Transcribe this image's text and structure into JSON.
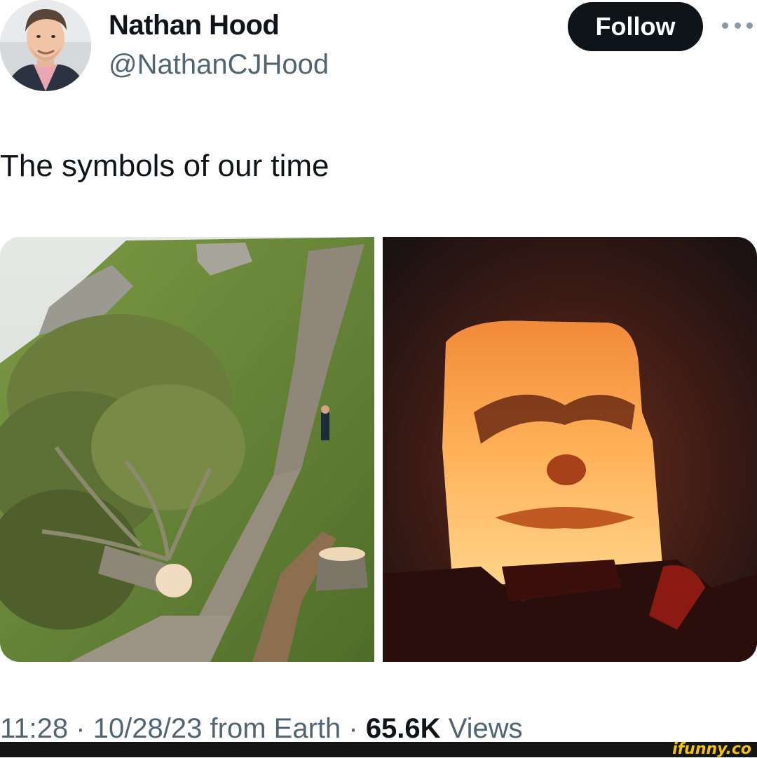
{
  "author": {
    "name": "Nathan Hood",
    "handle": "@NathanCJHood"
  },
  "follow_label": "Follow",
  "more_icon": "more-horizontal-icon",
  "tweet": {
    "text": "The symbols of our time"
  },
  "media": [
    {
      "description_icon": "photo-felled-tree"
    },
    {
      "description_icon": "photo-burning-effigy"
    }
  ],
  "meta": {
    "time": "11:28",
    "date": "10/28/23",
    "source": "from Earth",
    "views_count": "65.6K",
    "views_label": "Views"
  },
  "watermark": "ifunny.co",
  "colors": {
    "button_bg": "#0f1419",
    "handle_gray": "#536471",
    "watermark_yellow": "#f4c400"
  }
}
